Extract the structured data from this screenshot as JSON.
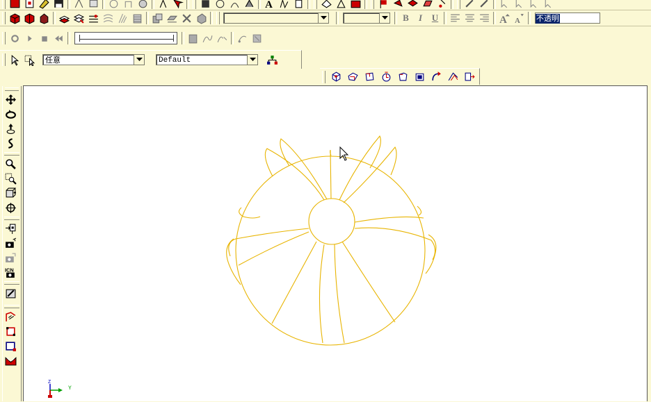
{
  "colors": {
    "toolbar_bg": "#fbf8d4",
    "canvas_bg": "#ffffff",
    "geometry": "#e8b400",
    "highlight": "#0a246a",
    "axis_x": "#00a000",
    "axis_z": "#0000c0"
  },
  "toolbar1": {
    "icons": [
      "new-part-icon",
      "open-icon",
      "save-as-icon",
      "save-icon",
      "cut-icon",
      "copy-icon",
      "paste-icon",
      "undo-icon",
      "redo-icon",
      "tree-icon",
      "select-arrow-icon",
      "box-icon",
      "cylinder-icon",
      "cone-icon",
      "sphere-icon",
      "torus-icon",
      "wedge-icon",
      "rotate-icon",
      "move-icon",
      "shell-icon",
      "fillet-icon",
      "print-icon"
    ],
    "font_value": "",
    "size_value": "",
    "text_value": "不透明"
  },
  "toolbar2": {
    "icons": [
      "extrude-icon",
      "revolve-icon",
      "sweep-icon",
      "loft-icon",
      "boolean-union-icon",
      "boolean-subtract-icon",
      "boolean-intersect-icon",
      "draft-icon",
      "section-icon",
      "blend-icon",
      "chamfer-icon",
      "face-offset-icon",
      "mirror-icon",
      "pattern-icon"
    ],
    "bold_label": "B",
    "italic_label": "I",
    "underline_label": "U"
  },
  "toolbar3": {
    "slider_value": 0
  },
  "selection_bar": {
    "filter_value": "任意",
    "style_value": "Default"
  },
  "view_bar": {
    "icons": [
      "view-iso-icon",
      "view-front-icon",
      "view-top-icon",
      "view-right-icon",
      "view-back-icon",
      "view-bottom-icon",
      "view-left-icon",
      "view-auxiliary-icon",
      "view-fit-icon"
    ]
  },
  "left_toolbar": {
    "icons": [
      "pan-icon",
      "rotate-view-icon",
      "dolly-icon",
      "twist-icon",
      "zoom-icon",
      "zoom-window-icon",
      "zoom-box-icon",
      "center-icon",
      "look-at-icon",
      "camera-icon",
      "camera-target-icon",
      "camera-position-icon",
      "render-icon",
      "sketch-plane-icon",
      "sketch-rect-icon",
      "sketch-face-icon",
      "sketch-curve-icon"
    ]
  },
  "triad": {
    "x_label": "Y",
    "z_label": "Z"
  }
}
